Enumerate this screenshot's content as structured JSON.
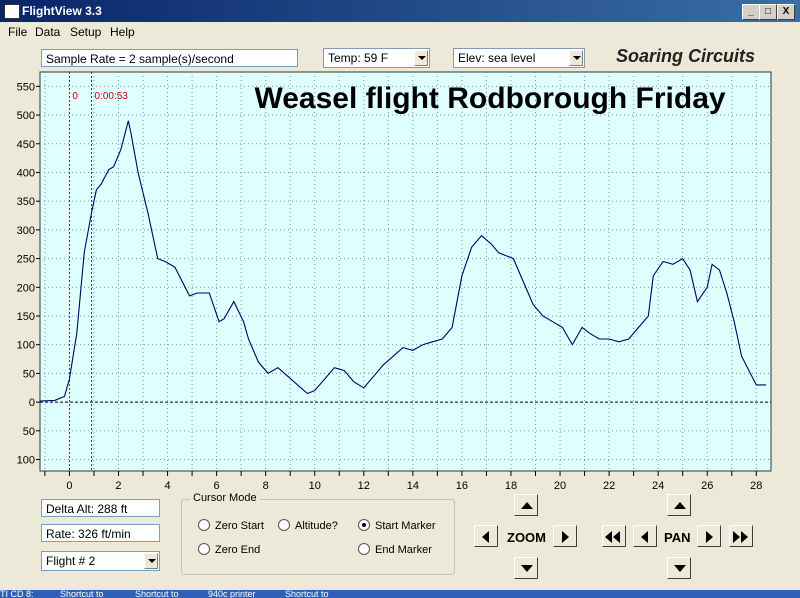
{
  "window": {
    "title": "FlightView 3.3",
    "minimize": "_",
    "maximize": "□",
    "close": "X"
  },
  "menu": [
    "File",
    "Data",
    "Setup",
    "Help"
  ],
  "toolbar": {
    "sample_rate": "Sample Rate =  2 sample(s)/second",
    "temp": "Temp:  59 F",
    "elev": "Elev: sea level",
    "brand": "Soaring Circuits"
  },
  "chart_data": {
    "type": "line",
    "title": "Weasel  flight Rodborough Friday",
    "xlim": [
      -1.2,
      28.6
    ],
    "ylim": [
      -120,
      575
    ],
    "x_ticks": [
      0,
      2,
      4,
      6,
      8,
      10,
      12,
      14,
      16,
      18,
      20,
      22,
      24,
      26,
      28
    ],
    "y_ticks": [
      {
        "v": 550,
        "label": "550"
      },
      {
        "v": 500,
        "label": "500"
      },
      {
        "v": 450,
        "label": "450"
      },
      {
        "v": 400,
        "label": "400"
      },
      {
        "v": 350,
        "label": "350"
      },
      {
        "v": 300,
        "label": "300"
      },
      {
        "v": 250,
        "label": "250"
      },
      {
        "v": 200,
        "label": "200"
      },
      {
        "v": 150,
        "label": "150"
      },
      {
        "v": 100,
        "label": "100"
      },
      {
        "v": 50,
        "label": "50"
      },
      {
        "v": 0,
        "label": "0"
      },
      {
        "v": -50,
        "label": "50"
      },
      {
        "v": -100,
        "label": "100"
      }
    ],
    "markers": [
      {
        "x": 0,
        "label": "0"
      },
      {
        "x": 0.9,
        "label": "0:00:53"
      }
    ],
    "grid": true,
    "colors": {
      "background": "#e0ffff",
      "line": "#000066",
      "marker": "#cc0000"
    },
    "series": [
      {
        "x": [
          -1.2,
          -0.6,
          -0.2,
          0,
          0.3,
          0.6,
          0.9,
          1.1,
          1.3,
          1.6,
          1.8,
          2.1,
          2.4,
          2.5,
          2.8,
          3.2,
          3.6,
          3.9,
          4.3,
          4.9,
          5.2,
          5.7,
          6.1,
          6.3,
          6.7,
          7.1,
          7.3,
          7.7,
          8.1,
          8.5,
          8.9,
          9.3,
          9.7,
          10,
          10.4,
          10.8,
          11.2,
          11.6,
          12,
          12.4,
          12.8,
          13.2,
          13.6,
          14,
          14.4,
          14.8,
          15.2,
          15.6,
          16,
          16.4,
          16.8,
          17.2,
          17.5,
          17.8,
          18.1,
          18.5,
          18.9,
          19.3,
          19.7,
          20.1,
          20.5,
          20.9,
          21.2,
          21.6,
          22,
          22.4,
          22.8,
          23.2,
          23.6,
          23.8,
          24.2,
          24.6,
          25,
          25.3,
          25.6,
          26,
          26.2,
          26.5,
          26.8,
          27.1,
          27.4,
          27.7,
          28,
          28.4
        ],
        "y": [
          2,
          3,
          10,
          40,
          120,
          260,
          330,
          370,
          380,
          405,
          410,
          440,
          490,
          470,
          400,
          330,
          250,
          245,
          235,
          185,
          190,
          190,
          140,
          145,
          175,
          140,
          110,
          70,
          50,
          60,
          45,
          30,
          15,
          20,
          40,
          60,
          55,
          35,
          25,
          45,
          65,
          80,
          95,
          90,
          100,
          105,
          110,
          130,
          220,
          270,
          290,
          275,
          260,
          255,
          250,
          210,
          170,
          150,
          140,
          130,
          100,
          130,
          120,
          110,
          110,
          105,
          110,
          130,
          150,
          220,
          245,
          240,
          250,
          230,
          175,
          200,
          240,
          230,
          190,
          140,
          80,
          55,
          30,
          30
        ]
      }
    ]
  },
  "stats": {
    "delta_alt": "Delta Alt: 288 ft",
    "rate": "Rate: 326 ft/min",
    "flight": "Flight # 2"
  },
  "cursor_mode": {
    "legend": "Cursor Mode",
    "options": [
      {
        "label": "Zero Start",
        "selected": false
      },
      {
        "label": "Altitude?",
        "selected": false
      },
      {
        "label": "Start Marker",
        "selected": true
      },
      {
        "label": "Zero End",
        "selected": false
      },
      {
        "label": "End Marker",
        "selected": false
      }
    ]
  },
  "zoom": {
    "label": "ZOOM"
  },
  "pan": {
    "label": "PAN"
  },
  "taskbar": [
    "TI CD 8:",
    "Shortcut to",
    "Shortcut to",
    "940c printer",
    "Shortcut to"
  ]
}
